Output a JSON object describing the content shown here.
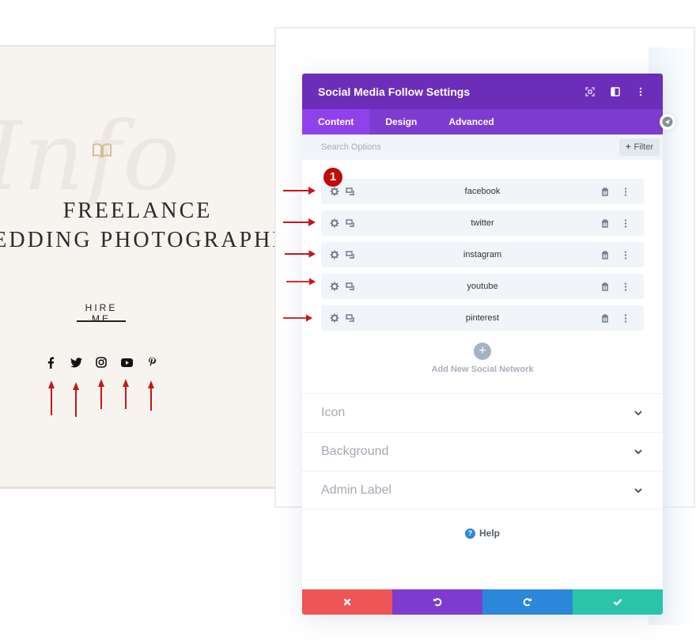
{
  "preview": {
    "script_text": "Info",
    "headline_line1": "FREELANCE",
    "headline_line2": "WEDDING PHOTOGRAPHER",
    "button_label": "HIRE ME",
    "social_icons": [
      "facebook-icon",
      "twitter-icon",
      "instagram-icon",
      "youtube-icon",
      "pinterest-icon"
    ]
  },
  "modal": {
    "title": "Social Media Follow Settings",
    "header_icons": [
      "expand-icon",
      "split-view-icon",
      "more-icon"
    ],
    "tabs": [
      {
        "label": "Content",
        "active": true
      },
      {
        "label": "Design",
        "active": false
      },
      {
        "label": "Advanced",
        "active": false
      }
    ],
    "search": {
      "placeholder": "Search Options",
      "value": ""
    },
    "filter_label": "Filter",
    "annotation_badge": "1",
    "networks": [
      {
        "label": "facebook"
      },
      {
        "label": "twitter"
      },
      {
        "label": "instagram"
      },
      {
        "label": "youtube"
      },
      {
        "label": "pinterest"
      }
    ],
    "add_label": "Add New Social Network",
    "sections": [
      {
        "label": "Icon"
      },
      {
        "label": "Background"
      },
      {
        "label": "Admin Label"
      }
    ],
    "help_label": "Help",
    "footer": [
      {
        "name": "cancel",
        "color": "#ef5555"
      },
      {
        "name": "undo",
        "color": "#7e3bd0"
      },
      {
        "name": "redo",
        "color": "#2b87da"
      },
      {
        "name": "save",
        "color": "#29c4a9"
      }
    ]
  },
  "colors": {
    "header": "#6c2eb9",
    "tabs": "#7e3bd0",
    "tab_active": "#8f42ec",
    "annotation": "#c10a0a"
  }
}
